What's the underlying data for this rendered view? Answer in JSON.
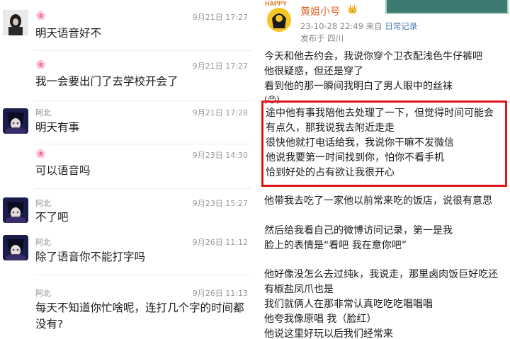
{
  "chat": {
    "messages": [
      {
        "sender": "",
        "badge": "🌸",
        "time": "9月21日 17:27",
        "text": "明天语音好不",
        "avatar": "dark-portrait"
      },
      {
        "sender": "",
        "badge": "🌸",
        "time": "9月21日 17:27",
        "text": "我一会要出门了去学校开会了",
        "avatar": ""
      },
      {
        "sender": "阿北",
        "badge": "",
        "time": "9月21日 17:28",
        "text": "明天有事",
        "avatar": "anime-portrait"
      },
      {
        "sender": "",
        "badge": "🌸",
        "time": "9月23日 14:30",
        "text": "可以语音吗",
        "avatar": ""
      },
      {
        "sender": "阿北",
        "badge": "",
        "time": "9月23日 15:27",
        "text": "不了吧",
        "avatar": "anime-portrait"
      },
      {
        "sender": "阿北",
        "badge": "",
        "time": "9月26日 11:12",
        "text": "除了语音你不能打字吗",
        "avatar": "anime-portrait"
      },
      {
        "sender": "阿北",
        "badge": "",
        "time": "9月26日 11:13",
        "text": "每天不知道你忙啥呢，连打几个字的时间都没有?",
        "avatar": ""
      }
    ]
  },
  "post": {
    "username": "黄姐小号",
    "crown": "👑",
    "avatar_text": "HAPPY",
    "date": "23-10-28 22:49",
    "from_label": "来自",
    "source": "日常记录",
    "location": "发布于 四川",
    "paragraphs": [
      "今天和他去约会，我说你穿个卫衣配浅色牛仔裤吧",
      "他很疑惑，但还是穿了",
      "看到他的那一瞬间我明白了男人眼中的丝袜",
      "(😍)",
      "途中他有事我陪他去处理了一下，但觉得时间可能会有点久，那我说我去附近走走",
      "很快他就打电话给我，我说你干嘛不发微信",
      "他说我要第一时间找到你，怕你不看手机",
      "恰到好处的占有欲让我很开心",
      "他带我去吃了一家他以前常来吃的饭店，说很有意思",
      "然后给我看自己的微博访问记录，第一是我",
      "脸上的表情是“看吧 我在意你吧”",
      "他好像没怎么去过纯k，我说走，那里卤肉饭巨好吃还有椒盐凤爪也是",
      "我们就俩人在那非常认真吃吃吃唱唱唱",
      "他夸我像原唱 我（脸红）",
      "他说这里好玩以后我们经常来"
    ]
  },
  "colors": {
    "highlight_border": "#e0141b",
    "username": "#e0642a",
    "source_link": "#4b78b8"
  }
}
